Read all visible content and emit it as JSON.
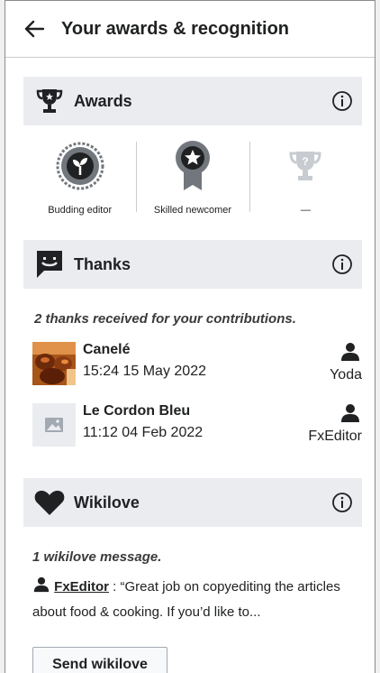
{
  "header": {
    "title": "Your awards & recognition",
    "back_icon": "arrow-left-icon"
  },
  "awards": {
    "title": "Awards",
    "items": [
      {
        "label": "Budding editor",
        "icon": "sprout-badge-icon"
      },
      {
        "label": "Skilled newcomer",
        "icon": "star-medal-icon"
      },
      {
        "label": "—",
        "icon": "locked-trophy-icon"
      }
    ]
  },
  "thanks": {
    "title": "Thanks",
    "summary": "2 thanks received for your contributions.",
    "items": [
      {
        "title": "Canelé",
        "time": "15:24 15 May 2022",
        "user": "Yoda"
      },
      {
        "title": "Le Cordon Bleu",
        "time": "11:12 04 Feb 2022",
        "user": "FxEditor"
      }
    ]
  },
  "wikilove": {
    "title": "Wikilove",
    "summary": "1 wikilove message.",
    "sender": "FxEditor",
    "message": " : “Great job on copyediting the articles about food & cooking. If you’d like to...",
    "button": "Send wikilove"
  },
  "colors": {
    "section_bg": "#eaecf0",
    "icon_dark": "#202122",
    "badge_gray": "#72777d",
    "locked_gray": "#c8ccd1"
  }
}
